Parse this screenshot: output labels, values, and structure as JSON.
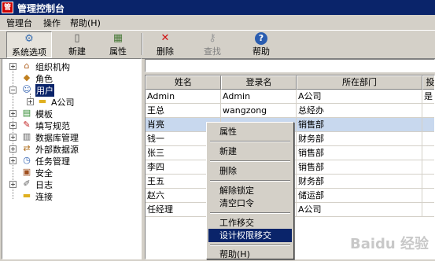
{
  "window": {
    "title": "管理控制台"
  },
  "menubar": [
    {
      "label": "管理台"
    },
    {
      "label": "操作"
    },
    {
      "label": "帮助(H)"
    }
  ],
  "toolbar": [
    {
      "label": "系统选项",
      "icon": "system-options-icon",
      "glyph": "⚙"
    },
    {
      "label": "新建",
      "icon": "new-document-icon",
      "glyph": "▯"
    },
    {
      "label": "属性",
      "icon": "properties-icon",
      "glyph": "▦"
    },
    {
      "label": "删除",
      "icon": "delete-x-icon",
      "glyph": "✕"
    },
    {
      "label": "查找",
      "icon": "key-find-icon",
      "glyph": "⚷"
    },
    {
      "label": "帮助",
      "icon": "help-icon",
      "glyph": "?"
    }
  ],
  "tree": [
    {
      "label": "组织机构",
      "icon": "house-icon",
      "glyph": "⌂",
      "expander": "+"
    },
    {
      "label": "角色",
      "icon": "role-icon",
      "glyph": "◆",
      "expander": ""
    },
    {
      "label": "用户",
      "icon": "user-icon",
      "glyph": "☺",
      "expander": "−"
    },
    {
      "label": "A公司",
      "icon": "folder-icon",
      "glyph": "▬",
      "expander": "+"
    },
    {
      "label": "模板",
      "icon": "template-icon",
      "glyph": "▤",
      "expander": "+"
    },
    {
      "label": "填写规范",
      "icon": "spec-abc-icon",
      "glyph": "✎",
      "expander": "+"
    },
    {
      "label": "数据库管理",
      "icon": "database-icon",
      "glyph": "▥",
      "expander": "+"
    },
    {
      "label": "外部数据源",
      "icon": "datasource-icon",
      "glyph": "⇄",
      "expander": "+"
    },
    {
      "label": "任务管理",
      "icon": "task-icon",
      "glyph": "◷",
      "expander": "+"
    },
    {
      "label": "安全",
      "icon": "security-icon",
      "glyph": "▣",
      "expander": ""
    },
    {
      "label": "日志",
      "icon": "log-icon",
      "glyph": "✐",
      "expander": "+"
    },
    {
      "label": "连接",
      "icon": "connection-folder-icon",
      "glyph": "▬",
      "expander": ""
    }
  ],
  "grid": {
    "headers": [
      "姓名",
      "登录名",
      "所在部门",
      "投"
    ],
    "rows": [
      [
        "Admin",
        "Admin",
        "A公司",
        "是"
      ],
      [
        "王总",
        "wangzong",
        "总经办",
        ""
      ],
      [
        "肖亮",
        "",
        "销售部",
        ""
      ],
      [
        "钱一",
        "",
        "财务部",
        ""
      ],
      [
        "张三",
        "",
        "销售部",
        ""
      ],
      [
        "李四",
        "",
        "销售部",
        ""
      ],
      [
        "王五",
        "",
        "财务部",
        ""
      ],
      [
        "赵六",
        "",
        "储运部",
        ""
      ],
      [
        "任经理",
        "",
        "A公司",
        ""
      ]
    ]
  },
  "context_menu": [
    {
      "label": "属性"
    },
    {
      "label": "新建"
    },
    {
      "label": "删除"
    },
    {
      "label": "解除锁定"
    },
    {
      "label": "清空口令"
    },
    {
      "label": "工作移交"
    },
    {
      "label": "设计权限移交"
    },
    {
      "label": "帮助(H)"
    }
  ],
  "watermark": "Baidu 经验",
  "colors": {
    "titlebar": "#0a246a",
    "selection": "#0a246a",
    "face": "#d4d0c8"
  }
}
